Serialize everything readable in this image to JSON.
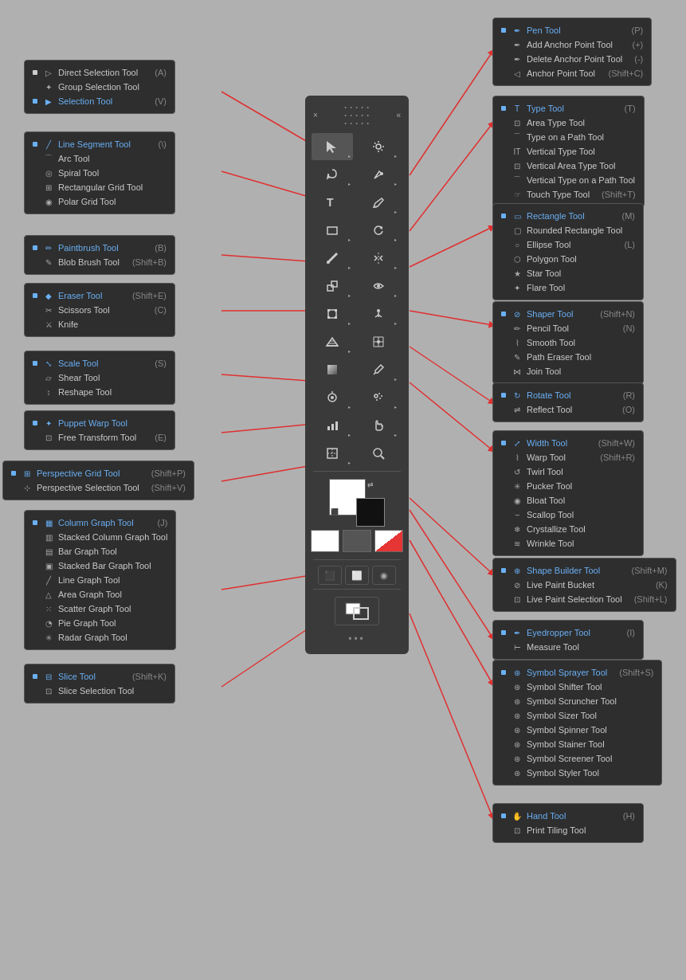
{
  "panel": {
    "close_icon": "×",
    "collapse_icon": "«",
    "dots": "•••"
  },
  "flyouts": {
    "selection": {
      "items": [
        {
          "label": "Direct Selection Tool",
          "shortcut": "(A)",
          "highlighted": false,
          "active": true
        },
        {
          "label": "Group Selection Tool",
          "shortcut": "",
          "highlighted": false,
          "active": false
        },
        {
          "label": "Selection Tool",
          "shortcut": "(V)",
          "highlighted": true,
          "active": true
        }
      ]
    },
    "line": {
      "items": [
        {
          "label": "Line Segment Tool",
          "shortcut": "(\\)",
          "highlighted": true,
          "active": true
        },
        {
          "label": "Arc Tool",
          "shortcut": "",
          "highlighted": false,
          "active": false
        },
        {
          "label": "Spiral Tool",
          "shortcut": "",
          "highlighted": false,
          "active": false
        },
        {
          "label": "Rectangular Grid Tool",
          "shortcut": "",
          "highlighted": false,
          "active": false
        },
        {
          "label": "Polar Grid Tool",
          "shortcut": "",
          "highlighted": false,
          "active": false
        }
      ]
    },
    "paintbrush": {
      "items": [
        {
          "label": "Paintbrush Tool",
          "shortcut": "(B)",
          "highlighted": true,
          "active": true
        },
        {
          "label": "Blob Brush Tool",
          "shortcut": "(Shift+B)",
          "highlighted": false,
          "active": false
        }
      ]
    },
    "eraser": {
      "items": [
        {
          "label": "Eraser Tool",
          "shortcut": "(Shift+E)",
          "highlighted": true,
          "active": true
        },
        {
          "label": "Scissors Tool",
          "shortcut": "(C)",
          "highlighted": false,
          "active": false
        },
        {
          "label": "Knife",
          "shortcut": "",
          "highlighted": false,
          "active": false
        }
      ]
    },
    "scale": {
      "items": [
        {
          "label": "Scale Tool",
          "shortcut": "(S)",
          "highlighted": true,
          "active": true
        },
        {
          "label": "Shear Tool",
          "shortcut": "",
          "highlighted": false,
          "active": false
        },
        {
          "label": "Reshape Tool",
          "shortcut": "",
          "highlighted": false,
          "active": false
        }
      ]
    },
    "puppet": {
      "items": [
        {
          "label": "Puppet Warp Tool",
          "shortcut": "",
          "highlighted": true,
          "active": true
        },
        {
          "label": "Free Transform Tool",
          "shortcut": "(E)",
          "highlighted": false,
          "active": false
        }
      ]
    },
    "perspective": {
      "items": [
        {
          "label": "Perspective Grid Tool",
          "shortcut": "(Shift+P)",
          "highlighted": true,
          "active": true
        },
        {
          "label": "Perspective Selection Tool",
          "shortcut": "(Shift+V)",
          "highlighted": false,
          "active": false
        }
      ]
    },
    "graph": {
      "items": [
        {
          "label": "Column Graph Tool",
          "shortcut": "(J)",
          "highlighted": true,
          "active": true
        },
        {
          "label": "Stacked Column Graph Tool",
          "shortcut": "",
          "highlighted": false,
          "active": false
        },
        {
          "label": "Bar Graph Tool",
          "shortcut": "",
          "highlighted": false,
          "active": false
        },
        {
          "label": "Stacked Bar Graph Tool",
          "shortcut": "",
          "highlighted": false,
          "active": false
        },
        {
          "label": "Line Graph Tool",
          "shortcut": "",
          "highlighted": false,
          "active": false
        },
        {
          "label": "Area Graph Tool",
          "shortcut": "",
          "highlighted": false,
          "active": false
        },
        {
          "label": "Scatter Graph Tool",
          "shortcut": "",
          "highlighted": false,
          "active": false
        },
        {
          "label": "Pie Graph Tool",
          "shortcut": "",
          "highlighted": false,
          "active": false
        },
        {
          "label": "Radar Graph Tool",
          "shortcut": "",
          "highlighted": false,
          "active": false
        }
      ]
    },
    "slice": {
      "items": [
        {
          "label": "Slice Tool",
          "shortcut": "(Shift+K)",
          "highlighted": true,
          "active": true
        },
        {
          "label": "Slice Selection Tool",
          "shortcut": "",
          "highlighted": false,
          "active": false
        }
      ]
    },
    "pen": {
      "items": [
        {
          "label": "Pen Tool",
          "shortcut": "(P)",
          "highlighted": true,
          "active": true
        },
        {
          "label": "Add Anchor Point Tool",
          "shortcut": "(+)",
          "highlighted": false,
          "active": false
        },
        {
          "label": "Delete Anchor Point Tool",
          "shortcut": "(-)",
          "highlighted": false,
          "active": false
        },
        {
          "label": "Anchor Point Tool",
          "shortcut": "(Shift+C)",
          "highlighted": false,
          "active": false
        }
      ]
    },
    "type": {
      "items": [
        {
          "label": "Type Tool",
          "shortcut": "(T)",
          "highlighted": true,
          "active": true
        },
        {
          "label": "Area Type Tool",
          "shortcut": "",
          "highlighted": false,
          "active": false
        },
        {
          "label": "Type on a Path Tool",
          "shortcut": "",
          "highlighted": false,
          "active": false
        },
        {
          "label": "Vertical Type Tool",
          "shortcut": "",
          "highlighted": false,
          "active": false
        },
        {
          "label": "Vertical Area Type Tool",
          "shortcut": "",
          "highlighted": false,
          "active": false
        },
        {
          "label": "Vertical Type on a Path Tool",
          "shortcut": "",
          "highlighted": false,
          "active": false
        },
        {
          "label": "Touch Type Tool",
          "shortcut": "(Shift+T)",
          "highlighted": false,
          "active": false
        }
      ]
    },
    "rectangle": {
      "items": [
        {
          "label": "Rectangle Tool",
          "shortcut": "(M)",
          "highlighted": true,
          "active": true
        },
        {
          "label": "Rounded Rectangle Tool",
          "shortcut": "",
          "highlighted": false,
          "active": false
        },
        {
          "label": "Ellipse Tool",
          "shortcut": "(L)",
          "highlighted": false,
          "active": false
        },
        {
          "label": "Polygon Tool",
          "shortcut": "",
          "highlighted": false,
          "active": false
        },
        {
          "label": "Star Tool",
          "shortcut": "",
          "highlighted": false,
          "active": false
        },
        {
          "label": "Flare Tool",
          "shortcut": "",
          "highlighted": false,
          "active": false
        }
      ]
    },
    "shaper": {
      "items": [
        {
          "label": "Shaper Tool",
          "shortcut": "(Shift+N)",
          "highlighted": true,
          "active": true
        },
        {
          "label": "Pencil Tool",
          "shortcut": "(N)",
          "highlighted": false,
          "active": false
        },
        {
          "label": "Smooth Tool",
          "shortcut": "",
          "highlighted": false,
          "active": false
        },
        {
          "label": "Path Eraser Tool",
          "shortcut": "",
          "highlighted": false,
          "active": false
        },
        {
          "label": "Join Tool",
          "shortcut": "",
          "highlighted": false,
          "active": false
        }
      ]
    },
    "rotate": {
      "items": [
        {
          "label": "Rotate Tool",
          "shortcut": "(R)",
          "highlighted": true,
          "active": true
        },
        {
          "label": "Reflect Tool",
          "shortcut": "(O)",
          "highlighted": false,
          "active": false
        }
      ]
    },
    "width": {
      "items": [
        {
          "label": "Width Tool",
          "shortcut": "(Shift+W)",
          "highlighted": true,
          "active": true
        },
        {
          "label": "Warp Tool",
          "shortcut": "(Shift+R)",
          "highlighted": false,
          "active": false
        },
        {
          "label": "Twirl Tool",
          "shortcut": "",
          "highlighted": false,
          "active": false
        },
        {
          "label": "Pucker Tool",
          "shortcut": "",
          "highlighted": false,
          "active": false
        },
        {
          "label": "Bloat Tool",
          "shortcut": "",
          "highlighted": false,
          "active": false
        },
        {
          "label": "Scallop Tool",
          "shortcut": "",
          "highlighted": false,
          "active": false
        },
        {
          "label": "Crystallize Tool",
          "shortcut": "",
          "highlighted": false,
          "active": false
        },
        {
          "label": "Wrinkle Tool",
          "shortcut": "",
          "highlighted": false,
          "active": false
        }
      ]
    },
    "shapebuilder": {
      "items": [
        {
          "label": "Shape Builder Tool",
          "shortcut": "(Shift+M)",
          "highlighted": true,
          "active": true
        },
        {
          "label": "Live Paint Bucket",
          "shortcut": "(K)",
          "highlighted": false,
          "active": false
        },
        {
          "label": "Live Paint Selection Tool",
          "shortcut": "(Shift+L)",
          "highlighted": false,
          "active": false
        }
      ]
    },
    "eyedropper": {
      "items": [
        {
          "label": "Eyedropper Tool",
          "shortcut": "(I)",
          "highlighted": true,
          "active": true
        },
        {
          "label": "Measure Tool",
          "shortcut": "",
          "highlighted": false,
          "active": false
        }
      ]
    },
    "symbol": {
      "items": [
        {
          "label": "Symbol Sprayer Tool",
          "shortcut": "(Shift+S)",
          "highlighted": true,
          "active": true
        },
        {
          "label": "Symbol Shifter Tool",
          "shortcut": "",
          "highlighted": false,
          "active": false
        },
        {
          "label": "Symbol Scruncher Tool",
          "shortcut": "",
          "highlighted": false,
          "active": false
        },
        {
          "label": "Symbol Sizer Tool",
          "shortcut": "",
          "highlighted": false,
          "active": false
        },
        {
          "label": "Symbol Spinner Tool",
          "shortcut": "",
          "highlighted": false,
          "active": false
        },
        {
          "label": "Symbol Stainer Tool",
          "shortcut": "",
          "highlighted": false,
          "active": false
        },
        {
          "label": "Symbol Screener Tool",
          "shortcut": "",
          "highlighted": false,
          "active": false
        },
        {
          "label": "Symbol Styler Tool",
          "shortcut": "",
          "highlighted": false,
          "active": false
        }
      ]
    },
    "hand": {
      "items": [
        {
          "label": "Hand Tool",
          "shortcut": "(H)",
          "highlighted": true,
          "active": true
        },
        {
          "label": "Print Tiling Tool",
          "shortcut": "",
          "highlighted": false,
          "active": false
        }
      ]
    }
  }
}
